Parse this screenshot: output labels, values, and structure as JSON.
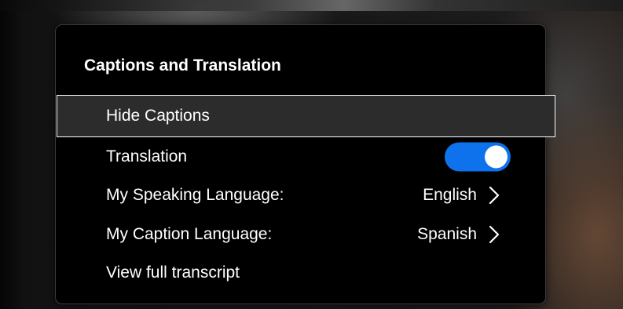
{
  "menu": {
    "title": "Captions and Translation",
    "items": [
      {
        "label": "Hide Captions"
      },
      {
        "label": "Translation",
        "toggle_on": true
      },
      {
        "label": "My Speaking Language:",
        "value": "English"
      },
      {
        "label": "My Caption Language:",
        "value": "Spanish"
      },
      {
        "label": "View full transcript"
      }
    ]
  },
  "icons": {
    "submenu_arrow": "chevron-right-icon"
  },
  "colors": {
    "menu_background": "#000000",
    "highlight_background": "#2c2c2c",
    "highlight_border": "#ffffff",
    "toggle_on": "#0e72ed",
    "text": "#ffffff"
  }
}
